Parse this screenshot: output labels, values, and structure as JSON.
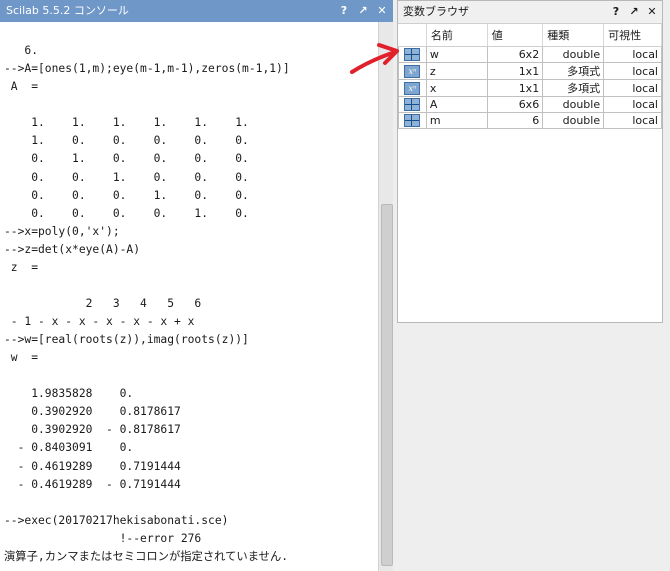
{
  "console": {
    "title": "Scilab 5.5.2 コンソール",
    "buttons": [
      "?",
      "↗",
      "✕"
    ],
    "lines": [
      "",
      "   6.",
      "-->A=[ones(1,m);eye(m-1,m-1),zeros(m-1,1)]",
      " A  =",
      "",
      "    1.    1.    1.    1.    1.    1.",
      "    1.    0.    0.    0.    0.    0.",
      "    0.    1.    0.    0.    0.    0.",
      "    0.    0.    1.    0.    0.    0.",
      "    0.    0.    0.    1.    0.    0.",
      "    0.    0.    0.    0.    1.    0.",
      "-->x=poly(0,'x');",
      "-->z=det(x*eye(A)-A)",
      " z  =",
      "",
      "            2   3   4   5   6",
      " - 1 - x - x - x - x - x + x",
      "-->w=[real(roots(z)),imag(roots(z))]",
      " w  =",
      "",
      "    1.9835828    0.",
      "    0.3902920    0.8178617",
      "    0.3902920  - 0.8178617",
      "  - 0.8403091    0.",
      "  - 0.4619289    0.7191444",
      "  - 0.4619289  - 0.7191444",
      "",
      "-->exec(20170217hekisabonati.sce)",
      "                 !--error 276",
      "演算子,カンマまたはセミコロンが指定されていません."
    ]
  },
  "variable_browser": {
    "title": "変数ブラウザ",
    "buttons": [
      "?",
      "↗",
      "✕"
    ],
    "columns": [
      "",
      "名前",
      "値",
      "種類",
      "可視性"
    ],
    "rows": [
      {
        "icon": "matrix-icon",
        "name": "w",
        "value": "6x2",
        "type": "double",
        "visibility": "local"
      },
      {
        "icon": "polynomial-icon",
        "name": "z",
        "value": "1x1",
        "type": "多項式",
        "visibility": "local"
      },
      {
        "icon": "polynomial-icon",
        "name": "x",
        "value": "1x1",
        "type": "多項式",
        "visibility": "local"
      },
      {
        "icon": "matrix-icon",
        "name": "A",
        "value": "6x6",
        "type": "double",
        "visibility": "local"
      },
      {
        "icon": "matrix-icon",
        "name": "m",
        "value": "6",
        "type": "double",
        "visibility": "local"
      }
    ]
  },
  "colors": {
    "console_titlebar": "#6f97c8",
    "annotation_arrow": "#e0202a"
  }
}
